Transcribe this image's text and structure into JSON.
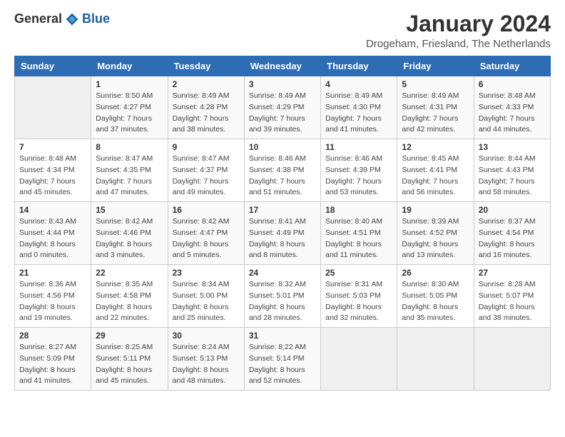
{
  "logo": {
    "general": "General",
    "blue": "Blue"
  },
  "header": {
    "title": "January 2024",
    "subtitle": "Drogeham, Friesland, The Netherlands"
  },
  "weekdays": [
    "Sunday",
    "Monday",
    "Tuesday",
    "Wednesday",
    "Thursday",
    "Friday",
    "Saturday"
  ],
  "weeks": [
    [
      {
        "day": "",
        "sunrise": "",
        "sunset": "",
        "daylight": ""
      },
      {
        "day": "1",
        "sunrise": "Sunrise: 8:50 AM",
        "sunset": "Sunset: 4:27 PM",
        "daylight": "Daylight: 7 hours and 37 minutes."
      },
      {
        "day": "2",
        "sunrise": "Sunrise: 8:49 AM",
        "sunset": "Sunset: 4:28 PM",
        "daylight": "Daylight: 7 hours and 38 minutes."
      },
      {
        "day": "3",
        "sunrise": "Sunrise: 8:49 AM",
        "sunset": "Sunset: 4:29 PM",
        "daylight": "Daylight: 7 hours and 39 minutes."
      },
      {
        "day": "4",
        "sunrise": "Sunrise: 8:49 AM",
        "sunset": "Sunset: 4:30 PM",
        "daylight": "Daylight: 7 hours and 41 minutes."
      },
      {
        "day": "5",
        "sunrise": "Sunrise: 8:49 AM",
        "sunset": "Sunset: 4:31 PM",
        "daylight": "Daylight: 7 hours and 42 minutes."
      },
      {
        "day": "6",
        "sunrise": "Sunrise: 8:48 AM",
        "sunset": "Sunset: 4:33 PM",
        "daylight": "Daylight: 7 hours and 44 minutes."
      }
    ],
    [
      {
        "day": "7",
        "sunrise": "Sunrise: 8:48 AM",
        "sunset": "Sunset: 4:34 PM",
        "daylight": "Daylight: 7 hours and 45 minutes."
      },
      {
        "day": "8",
        "sunrise": "Sunrise: 8:47 AM",
        "sunset": "Sunset: 4:35 PM",
        "daylight": "Daylight: 7 hours and 47 minutes."
      },
      {
        "day": "9",
        "sunrise": "Sunrise: 8:47 AM",
        "sunset": "Sunset: 4:37 PM",
        "daylight": "Daylight: 7 hours and 49 minutes."
      },
      {
        "day": "10",
        "sunrise": "Sunrise: 8:46 AM",
        "sunset": "Sunset: 4:38 PM",
        "daylight": "Daylight: 7 hours and 51 minutes."
      },
      {
        "day": "11",
        "sunrise": "Sunrise: 8:46 AM",
        "sunset": "Sunset: 4:39 PM",
        "daylight": "Daylight: 7 hours and 53 minutes."
      },
      {
        "day": "12",
        "sunrise": "Sunrise: 8:45 AM",
        "sunset": "Sunset: 4:41 PM",
        "daylight": "Daylight: 7 hours and 56 minutes."
      },
      {
        "day": "13",
        "sunrise": "Sunrise: 8:44 AM",
        "sunset": "Sunset: 4:43 PM",
        "daylight": "Daylight: 7 hours and 58 minutes."
      }
    ],
    [
      {
        "day": "14",
        "sunrise": "Sunrise: 8:43 AM",
        "sunset": "Sunset: 4:44 PM",
        "daylight": "Daylight: 8 hours and 0 minutes."
      },
      {
        "day": "15",
        "sunrise": "Sunrise: 8:42 AM",
        "sunset": "Sunset: 4:46 PM",
        "daylight": "Daylight: 8 hours and 3 minutes."
      },
      {
        "day": "16",
        "sunrise": "Sunrise: 8:42 AM",
        "sunset": "Sunset: 4:47 PM",
        "daylight": "Daylight: 8 hours and 5 minutes."
      },
      {
        "day": "17",
        "sunrise": "Sunrise: 8:41 AM",
        "sunset": "Sunset: 4:49 PM",
        "daylight": "Daylight: 8 hours and 8 minutes."
      },
      {
        "day": "18",
        "sunrise": "Sunrise: 8:40 AM",
        "sunset": "Sunset: 4:51 PM",
        "daylight": "Daylight: 8 hours and 11 minutes."
      },
      {
        "day": "19",
        "sunrise": "Sunrise: 8:39 AM",
        "sunset": "Sunset: 4:52 PM",
        "daylight": "Daylight: 8 hours and 13 minutes."
      },
      {
        "day": "20",
        "sunrise": "Sunrise: 8:37 AM",
        "sunset": "Sunset: 4:54 PM",
        "daylight": "Daylight: 8 hours and 16 minutes."
      }
    ],
    [
      {
        "day": "21",
        "sunrise": "Sunrise: 8:36 AM",
        "sunset": "Sunset: 4:56 PM",
        "daylight": "Daylight: 8 hours and 19 minutes."
      },
      {
        "day": "22",
        "sunrise": "Sunrise: 8:35 AM",
        "sunset": "Sunset: 4:58 PM",
        "daylight": "Daylight: 8 hours and 22 minutes."
      },
      {
        "day": "23",
        "sunrise": "Sunrise: 8:34 AM",
        "sunset": "Sunset: 5:00 PM",
        "daylight": "Daylight: 8 hours and 25 minutes."
      },
      {
        "day": "24",
        "sunrise": "Sunrise: 8:32 AM",
        "sunset": "Sunset: 5:01 PM",
        "daylight": "Daylight: 8 hours and 28 minutes."
      },
      {
        "day": "25",
        "sunrise": "Sunrise: 8:31 AM",
        "sunset": "Sunset: 5:03 PM",
        "daylight": "Daylight: 8 hours and 32 minutes."
      },
      {
        "day": "26",
        "sunrise": "Sunrise: 8:30 AM",
        "sunset": "Sunset: 5:05 PM",
        "daylight": "Daylight: 8 hours and 35 minutes."
      },
      {
        "day": "27",
        "sunrise": "Sunrise: 8:28 AM",
        "sunset": "Sunset: 5:07 PM",
        "daylight": "Daylight: 8 hours and 38 minutes."
      }
    ],
    [
      {
        "day": "28",
        "sunrise": "Sunrise: 8:27 AM",
        "sunset": "Sunset: 5:09 PM",
        "daylight": "Daylight: 8 hours and 41 minutes."
      },
      {
        "day": "29",
        "sunrise": "Sunrise: 8:25 AM",
        "sunset": "Sunset: 5:11 PM",
        "daylight": "Daylight: 8 hours and 45 minutes."
      },
      {
        "day": "30",
        "sunrise": "Sunrise: 8:24 AM",
        "sunset": "Sunset: 5:13 PM",
        "daylight": "Daylight: 8 hours and 48 minutes."
      },
      {
        "day": "31",
        "sunrise": "Sunrise: 8:22 AM",
        "sunset": "Sunset: 5:14 PM",
        "daylight": "Daylight: 8 hours and 52 minutes."
      },
      {
        "day": "",
        "sunrise": "",
        "sunset": "",
        "daylight": ""
      },
      {
        "day": "",
        "sunrise": "",
        "sunset": "",
        "daylight": ""
      },
      {
        "day": "",
        "sunrise": "",
        "sunset": "",
        "daylight": ""
      }
    ]
  ]
}
